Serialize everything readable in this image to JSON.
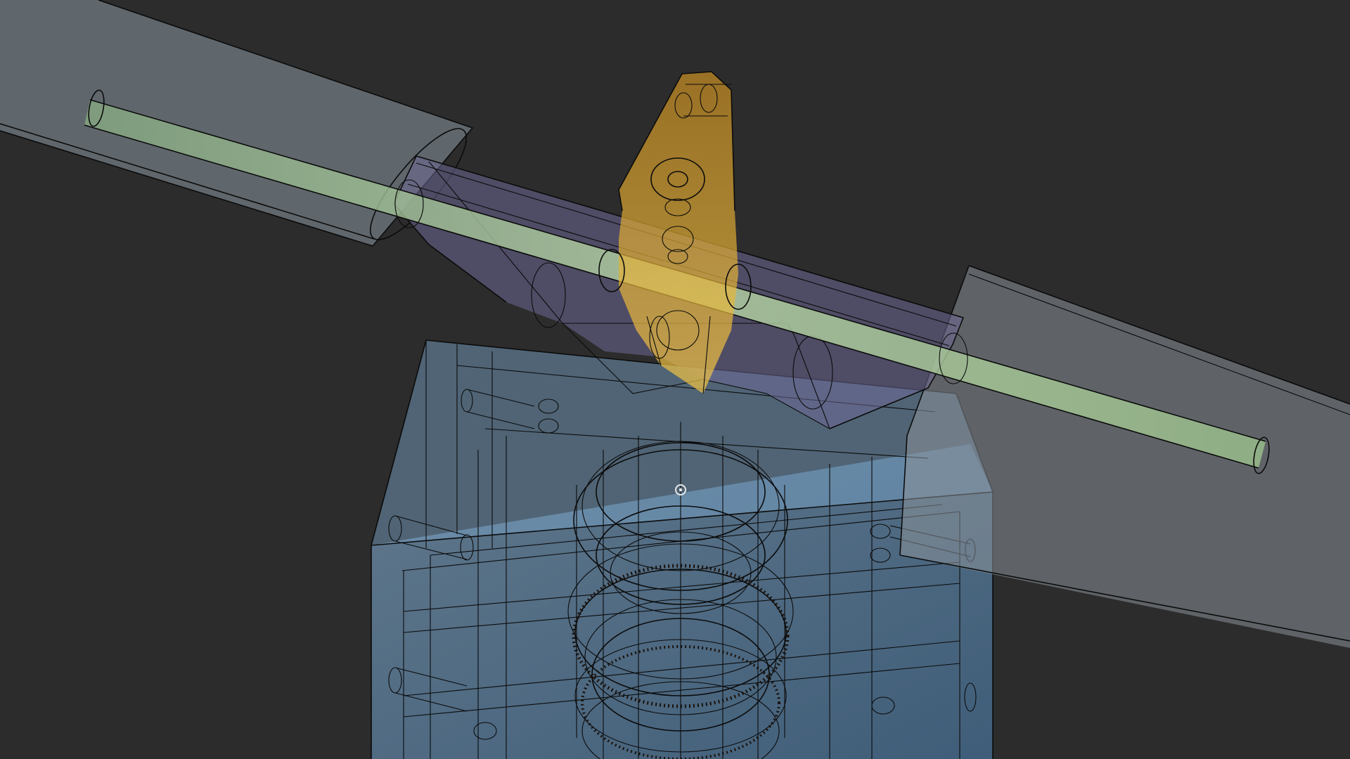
{
  "viewport": {
    "mode": "x-ray wireframe",
    "background_color": "#2c2c2c",
    "edge_color": "#0b0b0b",
    "pivot_icon": "orbit-pivot-icon"
  },
  "parts": [
    {
      "name": "left-blade-sleeve",
      "color": "#8d99a3"
    },
    {
      "name": "right-blade-sleeve",
      "color": "#8a9299"
    },
    {
      "name": "rotor-shaft",
      "color": "#9bc08c"
    },
    {
      "name": "hub-arm",
      "color": "#7a72a8"
    },
    {
      "name": "pitch-linkage",
      "color": "#e0a322"
    },
    {
      "name": "gear-assembly",
      "color": "#e08a4a"
    },
    {
      "name": "base-housing",
      "color": "#6ea8d8"
    }
  ]
}
